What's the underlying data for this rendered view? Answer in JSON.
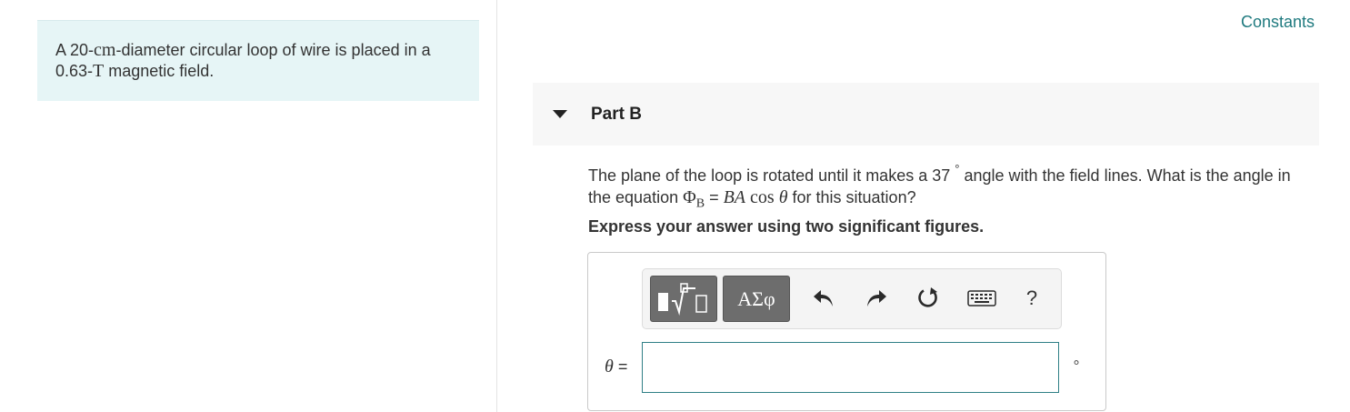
{
  "problem": {
    "text_before": "A 20-",
    "unit_cm": "cm",
    "text_mid": "-diameter circular loop of wire is placed in a 0.63-",
    "unit_T": "T",
    "text_after": " magnetic field."
  },
  "constants_link": "Constants",
  "part": {
    "title": "Part B",
    "question_1": "The plane of the loop is rotated until it makes a 37",
    "degree_symbol": "°",
    "question_2": " angle with the field lines. What is the angle in the equation ",
    "phi": "Φ",
    "phi_sub": "B",
    "equals": " = ",
    "BA": "BA",
    "cos": " cos ",
    "theta": "θ",
    "question_3": " for this situation?",
    "instruction": "Express your answer using two significant figures."
  },
  "toolbar": {
    "templates_icon": "templates-icon",
    "symbols_label": "ΑΣφ",
    "undo_icon": "undo-icon",
    "redo_icon": "redo-icon",
    "reset_icon": "reset-icon",
    "keyboard_icon": "keyboard-icon",
    "help_label": "?"
  },
  "answer": {
    "variable": "θ",
    "equals": " =",
    "value": "",
    "unit": "∘"
  }
}
